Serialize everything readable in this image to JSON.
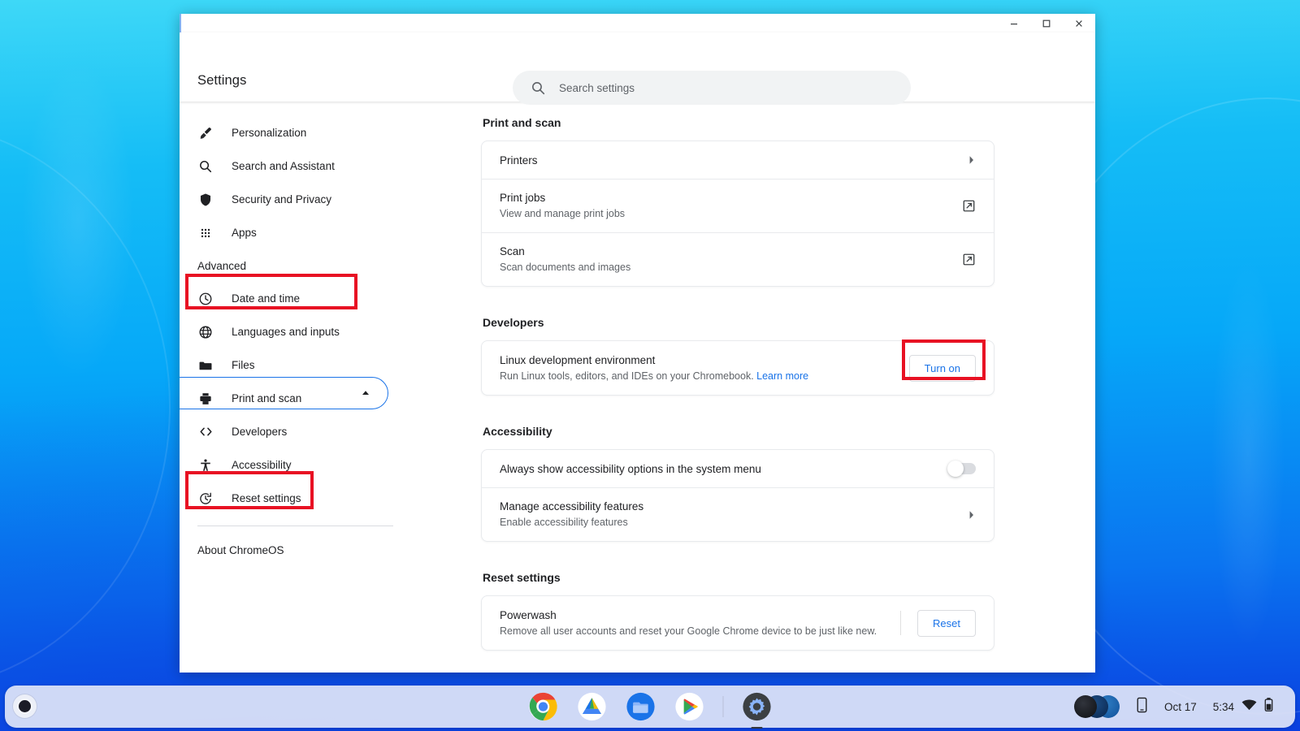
{
  "window": {
    "app_title": "Settings",
    "controls": [
      {
        "name": "minimize",
        "label": "–"
      },
      {
        "name": "maximize",
        "label": "□"
      },
      {
        "name": "close",
        "label": "×"
      }
    ]
  },
  "search": {
    "placeholder": "Search settings",
    "value": "",
    "icon": "search-icon"
  },
  "sidebar": {
    "items": [
      {
        "label": "Personalization",
        "icon": "brush-icon"
      },
      {
        "label": "Search and Assistant",
        "icon": "search-icon"
      },
      {
        "label": "Security and Privacy",
        "icon": "shield-icon"
      },
      {
        "label": "Apps",
        "icon": "grid-icon"
      }
    ],
    "advanced": {
      "label": "Advanced",
      "icon": "chevron-up-icon",
      "expanded": true
    },
    "advanced_items": [
      {
        "label": "Date and time",
        "icon": "clock-icon"
      },
      {
        "label": "Languages and inputs",
        "icon": "globe-icon"
      },
      {
        "label": "Files",
        "icon": "folder-icon"
      },
      {
        "label": "Print and scan",
        "icon": "printer-icon"
      },
      {
        "label": "Developers",
        "icon": "code-brackets-icon"
      },
      {
        "label": "Accessibility",
        "icon": "accessibility-person-icon"
      },
      {
        "label": "Reset settings",
        "icon": "reset-clock-icon"
      }
    ],
    "about": {
      "label": "About ChromeOS"
    }
  },
  "main": {
    "sections": [
      {
        "title": "Print and scan",
        "rows": [
          {
            "title": "Printers",
            "sub": "",
            "control": "chevron-right-icon"
          },
          {
            "title": "Print jobs",
            "sub": "View and manage print jobs",
            "control": "external-link-icon"
          },
          {
            "title": "Scan",
            "sub": "Scan documents and images",
            "control": "external-link-icon"
          }
        ]
      },
      {
        "title": "Developers",
        "rows": [
          {
            "title": "Linux development environment",
            "sub": "Run Linux tools, editors, and IDEs on your Chromebook.",
            "sub_link": "Learn more",
            "control": "button",
            "button_label": "Turn on"
          }
        ]
      },
      {
        "title": "Accessibility",
        "rows": [
          {
            "title": "Always show accessibility options in the system menu",
            "sub": "",
            "control": "toggle",
            "toggle_on": false
          },
          {
            "title": "Manage accessibility features",
            "sub": "Enable accessibility features",
            "control": "chevron-right-icon"
          }
        ]
      },
      {
        "title": "Reset settings",
        "rows": [
          {
            "title": "Powerwash",
            "sub": "Remove all user accounts and reset your Google Chrome device to be just like new.",
            "control": "button",
            "button_label": "Reset"
          }
        ]
      }
    ]
  },
  "annotations": {
    "color": "#e81123",
    "targets": [
      "Advanced",
      "Developers",
      "Turn on"
    ]
  },
  "shelf": {
    "launcher": "launcher-button",
    "apps": [
      {
        "name": "chrome",
        "label": "Chrome"
      },
      {
        "name": "drive",
        "label": "Google Drive"
      },
      {
        "name": "files",
        "label": "Files"
      },
      {
        "name": "play-store",
        "label": "Play Store"
      },
      {
        "name": "settings",
        "label": "Settings",
        "active": true
      }
    ],
    "tray": {
      "date": "Oct 17",
      "time": "5:34",
      "icons": [
        "avatar-cluster",
        "phone-hub-icon",
        "wifi-icon",
        "battery-icon"
      ]
    }
  },
  "theme": {
    "accent_blue": "#1a73e8",
    "text_primary": "#202124",
    "text_secondary": "#5f6368",
    "annotation_red": "#e81123",
    "card_border": "#e8eaed",
    "shelf_bg": "#dfe4f8"
  }
}
